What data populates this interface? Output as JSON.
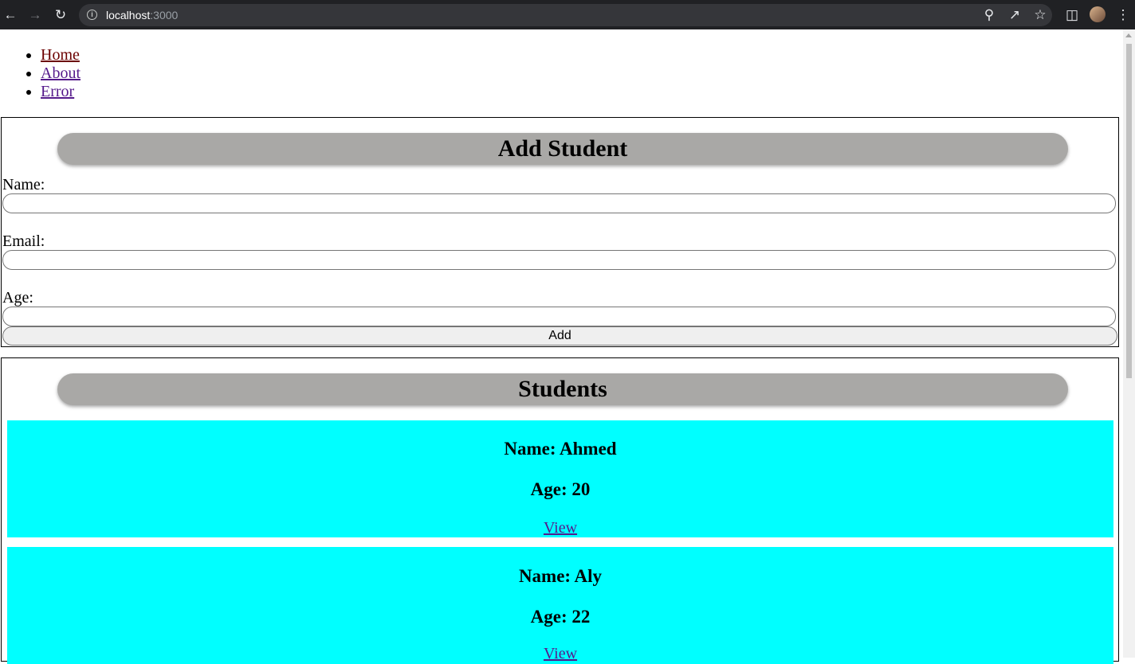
{
  "browser": {
    "url_host": "localhost",
    "url_port": ":3000",
    "icons": [
      "back-icon",
      "forward-icon",
      "reload-icon",
      "info-icon",
      "zoom-icon",
      "share-icon",
      "bookmark-star-icon",
      "side-panel-icon",
      "profile-avatar",
      "menu-dots-icon"
    ]
  },
  "nav": {
    "items": [
      {
        "label": "Home"
      },
      {
        "label": "About"
      },
      {
        "label": "Error"
      }
    ]
  },
  "add_form": {
    "title": "Add Student",
    "name_label": "Name:",
    "name_value": "",
    "email_label": "Email:",
    "email_value": "",
    "age_label": "Age:",
    "age_value": "",
    "submit_label": "Add"
  },
  "students": {
    "title": "Students",
    "items": [
      {
        "name": "Name: Ahmed",
        "age": "Age: 20",
        "link": "View"
      },
      {
        "name": "Name: Aly",
        "age": "Age: 22",
        "link": "View"
      }
    ]
  },
  "colors": {
    "card_bg": "#00ffff",
    "pill_bg": "#a9a8a6",
    "link_visited": "#551a8b"
  }
}
